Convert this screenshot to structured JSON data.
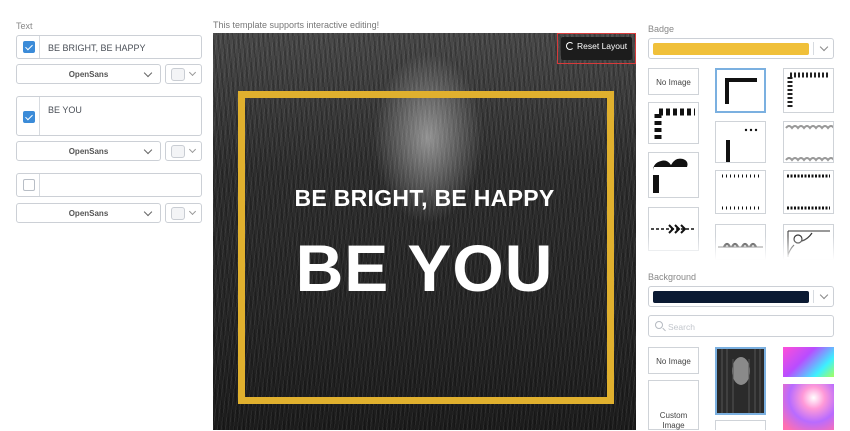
{
  "text_panel": {
    "label": "Text",
    "rows": [
      {
        "checked": true,
        "value": "BE BRIGHT, BE HAPPY",
        "font": "OpenSans"
      },
      {
        "checked": true,
        "value": "BE YOU",
        "font": "OpenSans"
      },
      {
        "checked": false,
        "value": "",
        "font": "OpenSans"
      }
    ]
  },
  "canvas": {
    "hint": "This template supports interactive editing!",
    "reset_label": "Reset Layout",
    "headline_small": "BE BRIGHT, BE HAPPY",
    "headline_large": "BE YOU",
    "frame_color": "#e0b02e"
  },
  "badge": {
    "label": "Badge",
    "selected_color": "#f0c03a",
    "no_image_label": "No Image",
    "tiles": [
      "no-image",
      "corner-bracket-thick",
      "corner-dots-stamp",
      "corner-stripes",
      "corner-line-dots",
      "scallop-border",
      "corner-ornament-black",
      "dotted-line-border",
      "dotted-bar-border",
      "arrow-divider",
      "leaf-vine-divider",
      "floral-corner"
    ]
  },
  "background": {
    "label": "Background",
    "selected_color": "#0b1a33",
    "search_placeholder": "Search",
    "no_image_label": "No Image",
    "custom_image_label": "Custom Image"
  }
}
